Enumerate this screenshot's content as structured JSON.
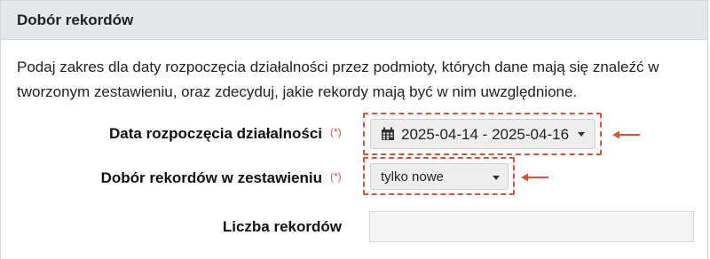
{
  "panel": {
    "title": "Dobór rekordów",
    "intro": "Podaj zakres dla daty rozpoczęcia działalności przez podmioty, których dane mają się znaleźć w tworzonym zestawieniu, oraz zdecyduj, jakie rekordy mają być w nim uwzględnione."
  },
  "form": {
    "required_marker": "(*)",
    "date_range": {
      "label": "Data rozpoczęcia działalności",
      "value": "2025-04-14 - 2025-04-16",
      "icon": "calendar-icon"
    },
    "record_selection": {
      "label": "Dobór rekordów w zestawieniu",
      "value": "tylko nowe"
    },
    "record_count": {
      "label": "Liczba rekordów",
      "value": ""
    }
  },
  "colors": {
    "header_bg": "#e4e7eb",
    "highlight": "#e0512f",
    "required": "#d9534f"
  }
}
